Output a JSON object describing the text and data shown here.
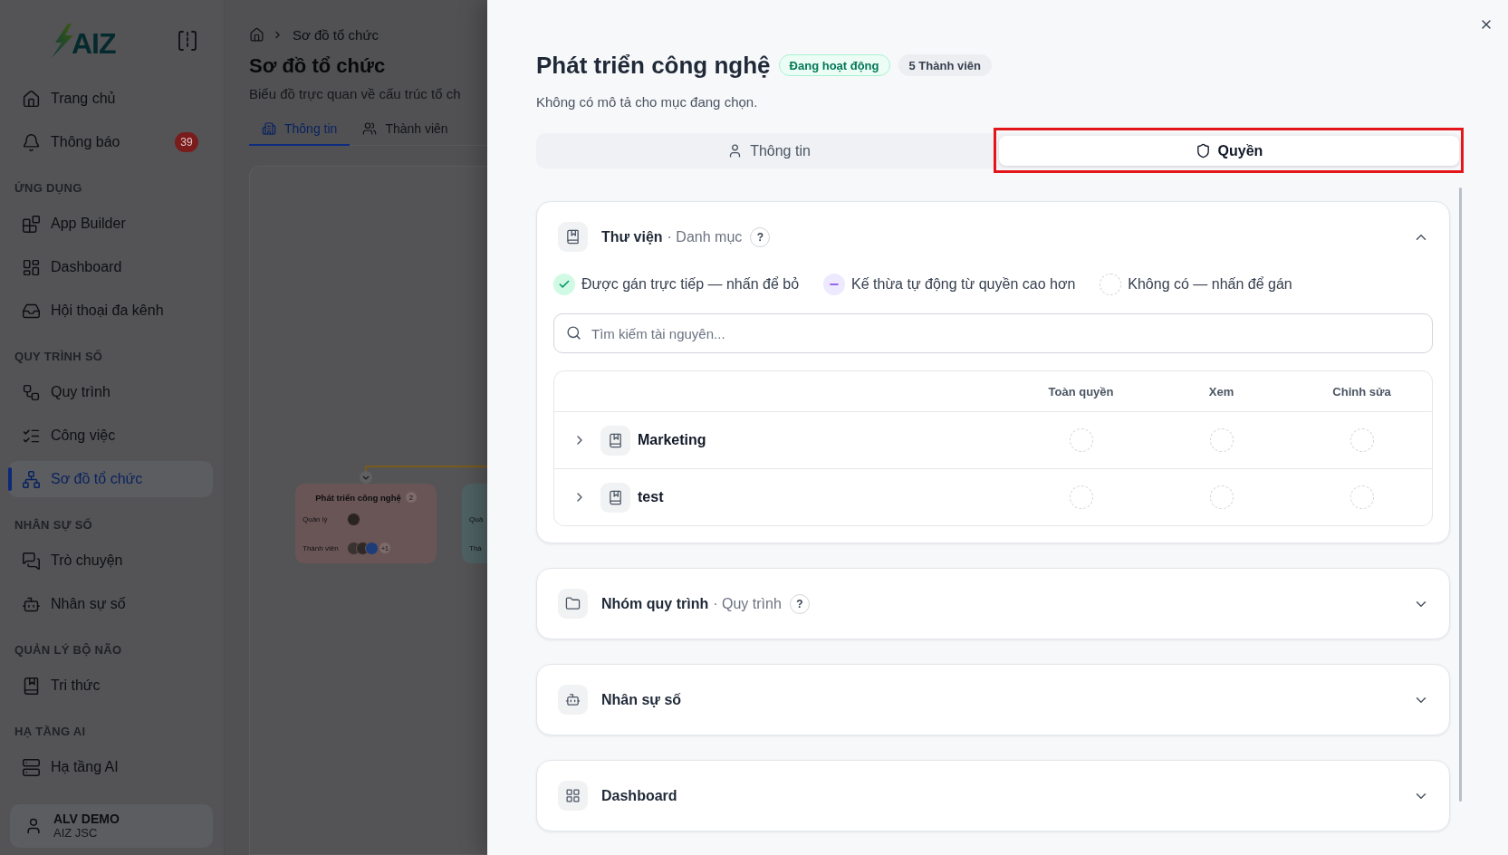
{
  "sidebar": {
    "logo": "AIZ",
    "sections": [
      {
        "items": [
          {
            "label": "Trang chủ",
            "selected": false
          },
          {
            "label": "Thông báo",
            "selected": false,
            "count": "39"
          }
        ]
      },
      {
        "title": "ỨNG DỤNG",
        "items": [
          {
            "label": "App Builder",
            "selected": false
          },
          {
            "label": "Dashboard",
            "selected": false
          },
          {
            "label": "Hội thoại đa kênh",
            "selected": false
          }
        ]
      },
      {
        "title": "QUY TRÌNH SỐ",
        "items": [
          {
            "label": "Quy trình",
            "selected": false
          },
          {
            "label": "Công việc",
            "selected": false
          },
          {
            "label": "Sơ đồ tổ chức",
            "selected": true
          }
        ]
      },
      {
        "title": "NHÂN SỰ SỐ",
        "items": [
          {
            "label": "Trò chuyện",
            "selected": false
          },
          {
            "label": "Nhân sự số",
            "selected": false
          }
        ]
      },
      {
        "title": "QUẢN LÝ BỘ NÃO",
        "items": [
          {
            "label": "Tri thức",
            "selected": false
          }
        ]
      },
      {
        "title": "HẠ TẦNG AI",
        "items": [
          {
            "label": "Hạ tầng AI",
            "selected": false
          }
        ]
      }
    ],
    "user": {
      "name": "ALV DEMO",
      "company": "AIZ JSC"
    }
  },
  "main": {
    "breadcrumb": "Sơ đồ tổ chức",
    "title": "Sơ đồ tổ chức",
    "subtitle": "Biểu đồ trực quan về cấu trúc tổ ch",
    "tabs": [
      {
        "label": "Thông tin",
        "selected": true
      },
      {
        "label": "Thành viên",
        "selected": false
      }
    ],
    "org_chart": {
      "nodes": [
        {
          "title": "Phát triển công nghệ",
          "count": "2",
          "color": "#6a5556",
          "manager_label": "Quản lý",
          "members_label": "Thành viên",
          "more_members": "+1"
        },
        {
          "color": "#4e6163",
          "manager_label": "Quả",
          "members_label": "Thà"
        }
      ]
    }
  },
  "drawer": {
    "title": "Phát triển công nghệ",
    "status": "Đang hoạt động",
    "members": "5 Thành viên",
    "description": "Không có mô tả cho mục đang chọn.",
    "tabs": [
      {
        "label": "Thông tin",
        "selected": false,
        "highlighted": false
      },
      {
        "label": "Quyền",
        "selected": true,
        "highlighted": true
      }
    ],
    "sections": [
      {
        "title": "Thư viện",
        "subtitle": "· Danh mục",
        "help": "?",
        "expanded": true,
        "legend": [
          {
            "kind": "direct",
            "label": "Được gán trực tiếp — nhấn để bỏ"
          },
          {
            "kind": "inherited",
            "label": "Kế thừa tự động từ quyền cao hơn"
          },
          {
            "kind": "none",
            "label": "Không có — nhấn để gán"
          }
        ],
        "search": {
          "placeholder": "Tìm kiếm tài nguyên..."
        },
        "table": {
          "columns": [
            "Toàn quyền",
            "Xem",
            "Chỉnh sửa"
          ],
          "rows": [
            {
              "name": "Marketing",
              "expanded": false,
              "permissions": [
                {
                  "kind": "none"
                },
                {
                  "kind": "none"
                },
                {
                  "kind": "none"
                }
              ]
            },
            {
              "name": "test",
              "expanded": false,
              "permissions": [
                {
                  "kind": "none"
                },
                {
                  "kind": "none"
                },
                {
                  "kind": "none"
                }
              ]
            }
          ]
        }
      },
      {
        "title": "Nhóm quy trình",
        "subtitle": "· Quy trình",
        "help": "?",
        "expanded": false
      },
      {
        "title": "Nhân sự số",
        "expanded": false
      },
      {
        "title": "Dashboard",
        "expanded": false
      }
    ]
  }
}
